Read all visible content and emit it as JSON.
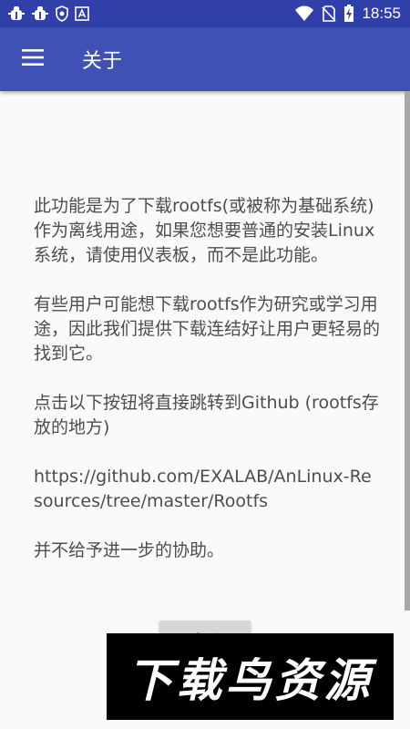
{
  "statusbar": {
    "time": "18:55",
    "icons": [
      "bug-icon",
      "bug-icon",
      "shield-icon",
      "app-a-icon",
      "wifi-icon",
      "no-sim-icon",
      "battery-charging-icon"
    ]
  },
  "appbar": {
    "title": "关于",
    "menu_icon": "hamburger-menu-icon"
  },
  "content": {
    "paragraphs": [
      "此功能是为了下载rootfs(或被称为基础系统)作为离线用途，如果您想要普通的安装Linux系统，请使用仪表板，而不是此功能。",
      "有些用户可能想下载rootfs作为研究或学习用途，因此我们提供下载连结好让用户更轻易的找到它。",
      "点击以下按钮将直接跳转到Github (rootfs存放的地方)",
      "https://github.com/EXALAB/AnLinux-Resources/tree/master/Rootfs",
      "并不给予进一步的协助。"
    ],
    "button_label": "查看"
  },
  "watermark": {
    "text": "下载鸟资源"
  },
  "colors": {
    "statusbar": "#3140a8",
    "appbar": "#3f51b5",
    "background": "#fafafa",
    "text": "#4d4d4d",
    "button": "#d6d6d6"
  }
}
